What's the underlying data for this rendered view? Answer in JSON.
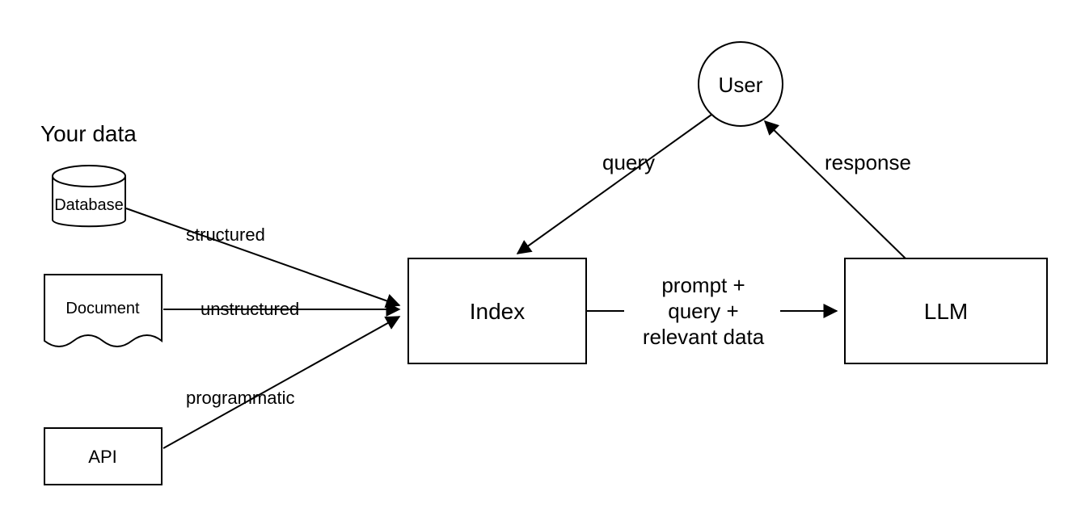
{
  "heading": "Your data",
  "nodes": {
    "database": "Database",
    "document": "Document",
    "api": "API",
    "index": "Index",
    "llm": "LLM",
    "user": "User"
  },
  "edges": {
    "structured": "structured",
    "unstructured": "unstructured",
    "programmatic": "programmatic",
    "query": "query",
    "response": "response",
    "prompt_multiline": [
      "prompt +",
      "query +",
      "relevant data"
    ]
  },
  "chart_data": {
    "type": "diagram",
    "title": "RAG / LLM data flow",
    "nodes": [
      {
        "id": "database",
        "label": "Database",
        "shape": "cylinder",
        "group": "your_data"
      },
      {
        "id": "document",
        "label": "Document",
        "shape": "document",
        "group": "your_data"
      },
      {
        "id": "api",
        "label": "API",
        "shape": "rect",
        "group": "your_data"
      },
      {
        "id": "index",
        "label": "Index",
        "shape": "rect"
      },
      {
        "id": "llm",
        "label": "LLM",
        "shape": "rect"
      },
      {
        "id": "user",
        "label": "User",
        "shape": "circle"
      }
    ],
    "groups": [
      {
        "id": "your_data",
        "label": "Your data"
      }
    ],
    "edges": [
      {
        "from": "database",
        "to": "index",
        "label": "structured",
        "directed": true
      },
      {
        "from": "document",
        "to": "index",
        "label": "unstructured",
        "directed": true
      },
      {
        "from": "api",
        "to": "index",
        "label": "programmatic",
        "directed": true
      },
      {
        "from": "user",
        "to": "index",
        "label": "query",
        "directed": true
      },
      {
        "from": "index",
        "to": "llm",
        "label": "prompt + query + relevant data",
        "directed": true
      },
      {
        "from": "llm",
        "to": "user",
        "label": "response",
        "directed": true
      }
    ]
  }
}
